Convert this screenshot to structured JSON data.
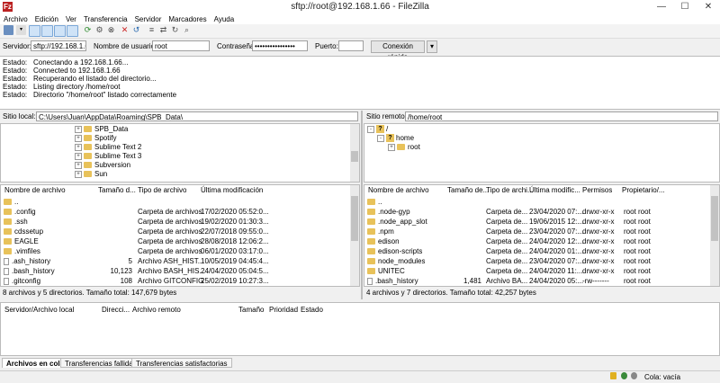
{
  "window": {
    "title": "sftp://root@192.168.1.66 - FileZilla",
    "logo": "Fz",
    "min": "—",
    "max": "☐",
    "close": "✕"
  },
  "menu": [
    "Archivo",
    "Edición",
    "Ver",
    "Transferencia",
    "Servidor",
    "Marcadores",
    "Ayuda"
  ],
  "toolbar_icons": [
    "site-manager-icon",
    "toggle-log-icon",
    "toggle-local-tree-icon",
    "toggle-remote-tree-icon",
    "toggle-queue-icon",
    "refresh-icon",
    "process-queue-icon",
    "cancel-icon",
    "disconnect-icon",
    "reconnect-icon",
    "filter-icon",
    "compare-icon",
    "sync-browse-icon",
    "search-icon"
  ],
  "quickconnect": {
    "server_label": "Servidor:",
    "server_value": "sftp://192.168.1.66",
    "user_label": "Nombre de usuario:",
    "user_value": "root",
    "pass_label": "Contraseña:",
    "pass_value": "••••••••••••••••",
    "port_label": "Puerto:",
    "port_value": "",
    "button": "Conexión rápida",
    "dropdown": "▾"
  },
  "log": [
    {
      "k": "Estado:",
      "v": "Conectando a 192.168.1.66..."
    },
    {
      "k": "Estado:",
      "v": "Connected to 192.168.1.66"
    },
    {
      "k": "Estado:",
      "v": "Recuperando el listado del directorio..."
    },
    {
      "k": "Estado:",
      "v": "Listing directory /home/root"
    },
    {
      "k": "Estado:",
      "v": "Directorio \"/home/root\" listado correctamente"
    }
  ],
  "local": {
    "path_label": "Sitio local:",
    "path": "C:\\Users\\Juan\\AppData\\Roaming\\SPB_Data\\",
    "tree": [
      "SPB_Data",
      "Spotify",
      "Sublime Text 2",
      "Sublime Text 3",
      "Subversion",
      "Sun"
    ],
    "headers": [
      "Nombre de archivo",
      "Tamaño d...",
      "Tipo de archivo",
      "Última modificación"
    ],
    "rows": [
      [
        "..",
        "",
        "",
        ""
      ],
      [
        ".config",
        "",
        "Carpeta de archivos",
        "17/02/2020 05:52:0..."
      ],
      [
        ".ssh",
        "",
        "Carpeta de archivos",
        "19/02/2020 01:30:3..."
      ],
      [
        "cdssetup",
        "",
        "Carpeta de archivos",
        "22/07/2018 09:55:0..."
      ],
      [
        "EAGLE",
        "",
        "Carpeta de archivos",
        "28/08/2018 12:06:2..."
      ],
      [
        ".vimfiles",
        "",
        "Carpeta de archivos",
        "06/01/2020 03:17:0..."
      ],
      [
        ".ash_history",
        "5",
        "Archivo ASH_HIST...",
        "10/05/2019 04:45:4..."
      ],
      [
        ".bash_history",
        "10,123",
        "Archivo BASH_HIS...",
        "24/04/2020 05:04:5..."
      ],
      [
        ".gitconfig",
        "108",
        "Archivo GITCONFIG",
        "25/02/2019 10:27:3..."
      ]
    ],
    "status": "8 archivos y 5 directorios. Tamaño total: 147,679 bytes"
  },
  "remote": {
    "path_label": "Sitio remoto:",
    "path": "/home/root",
    "tree": [
      "/",
      "home",
      "root"
    ],
    "headers": [
      "Nombre de archivo",
      "Tamaño de...",
      "Tipo de archi...",
      "Última modific...",
      "Permisos",
      "Propietario/..."
    ],
    "rows": [
      [
        "..",
        "",
        "",
        "",
        "",
        ""
      ],
      [
        ".node-gyp",
        "",
        "Carpeta de...",
        "23/04/2020 07:...",
        "drwxr-xr-x",
        "root root"
      ],
      [
        ".node_app_slot",
        "",
        "Carpeta de...",
        "19/06/2015 12:...",
        "drwxr-xr-x",
        "root root"
      ],
      [
        ".npm",
        "",
        "Carpeta de...",
        "23/04/2020 07:...",
        "drwxr-xr-x",
        "root root"
      ],
      [
        "edison",
        "",
        "Carpeta de...",
        "24/04/2020 12:...",
        "drwxr-xr-x",
        "root root"
      ],
      [
        "edison-scripts",
        "",
        "Carpeta de...",
        "24/04/2020 01:...",
        "drwxr-xr-x",
        "root root"
      ],
      [
        "node_modules",
        "",
        "Carpeta de...",
        "23/04/2020 07:...",
        "drwxr-xr-x",
        "root root"
      ],
      [
        "UNITEC",
        "",
        "Carpeta de...",
        "24/04/2020 11:...",
        "drwxr-xr-x",
        "root root"
      ],
      [
        ".bash_history",
        "1,481",
        "Archivo BA...",
        "24/04/2020 05:...",
        "-rw-------",
        "root root"
      ]
    ],
    "status": "4 archivos y 7 directorios. Tamaño total: 42,257 bytes"
  },
  "queue": {
    "headers": [
      "Servidor/Archivo local",
      "Direcci...",
      "Archivo remoto",
      "Tamaño",
      "Prioridad",
      "Estado"
    ]
  },
  "tabs": [
    "Archivos en cola",
    "Transferencias fallidas",
    "Transferencias satisfactorias"
  ],
  "statusbar": {
    "queue": "Cola: vacía"
  }
}
